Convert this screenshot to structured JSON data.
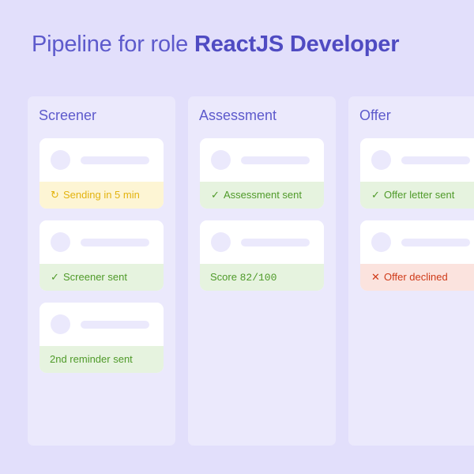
{
  "header": {
    "prefix": "Pipeline for role",
    "role": "ReactJS Developer"
  },
  "columns": [
    {
      "title": "Screener",
      "cards": [
        {
          "status_text": "Sending in 5 min",
          "status_type": "pending",
          "icon": "refresh-icon"
        },
        {
          "status_text": "Screener sent",
          "status_type": "success",
          "icon": "check-icon"
        },
        {
          "status_text": "2nd reminder sent",
          "status_type": "success",
          "icon": ""
        }
      ]
    },
    {
      "title": "Assessment",
      "cards": [
        {
          "status_text": "Assessment sent",
          "status_type": "success",
          "icon": "check-icon"
        },
        {
          "status_label": "Score",
          "status_value": "82/100",
          "status_type": "success",
          "icon": ""
        }
      ]
    },
    {
      "title": "Offer",
      "cards": [
        {
          "status_text": "Offer letter sent",
          "status_type": "success",
          "icon": "check-icon"
        },
        {
          "status_text": "Offer declined",
          "status_type": "error",
          "icon": "close-icon"
        }
      ]
    }
  ],
  "colors": {
    "background": "#e2dffb",
    "column": "#ebe9fc",
    "accent": "#5d5acc",
    "pending": "#e3b30f",
    "success": "#4f9a29",
    "error": "#cf3a18"
  }
}
